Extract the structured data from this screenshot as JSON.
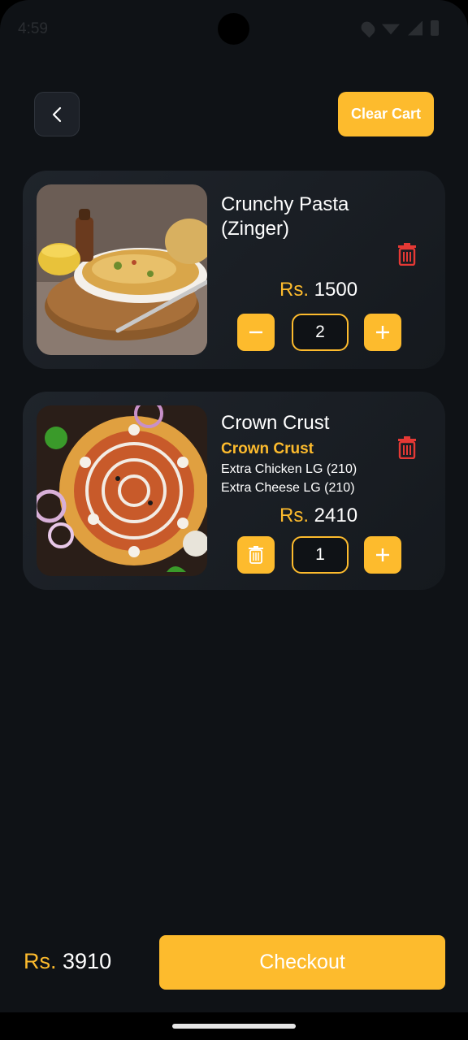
{
  "status_bar": {
    "time": "4:59"
  },
  "header": {
    "clear_cart_label": "Clear Cart"
  },
  "currency": "Rs.",
  "items": [
    {
      "name_line1": "Crunchy Pasta",
      "name_line2": "(Zinger)",
      "price": "1500",
      "quantity": "2",
      "decrement_icon": "minus-icon"
    },
    {
      "name_line1": "Crown Crust",
      "variant": "Crown Crust",
      "addons": [
        "Extra Chicken LG (210)",
        "Extra Cheese LG (210)"
      ],
      "price": "2410",
      "quantity": "1",
      "decrement_icon": "trash-icon"
    }
  ],
  "footer": {
    "total": "3910",
    "checkout_label": "Checkout"
  },
  "colors": {
    "accent": "#fdbb2d",
    "background": "#0f1216",
    "card": "#1f242b",
    "delete": "#e53935"
  }
}
